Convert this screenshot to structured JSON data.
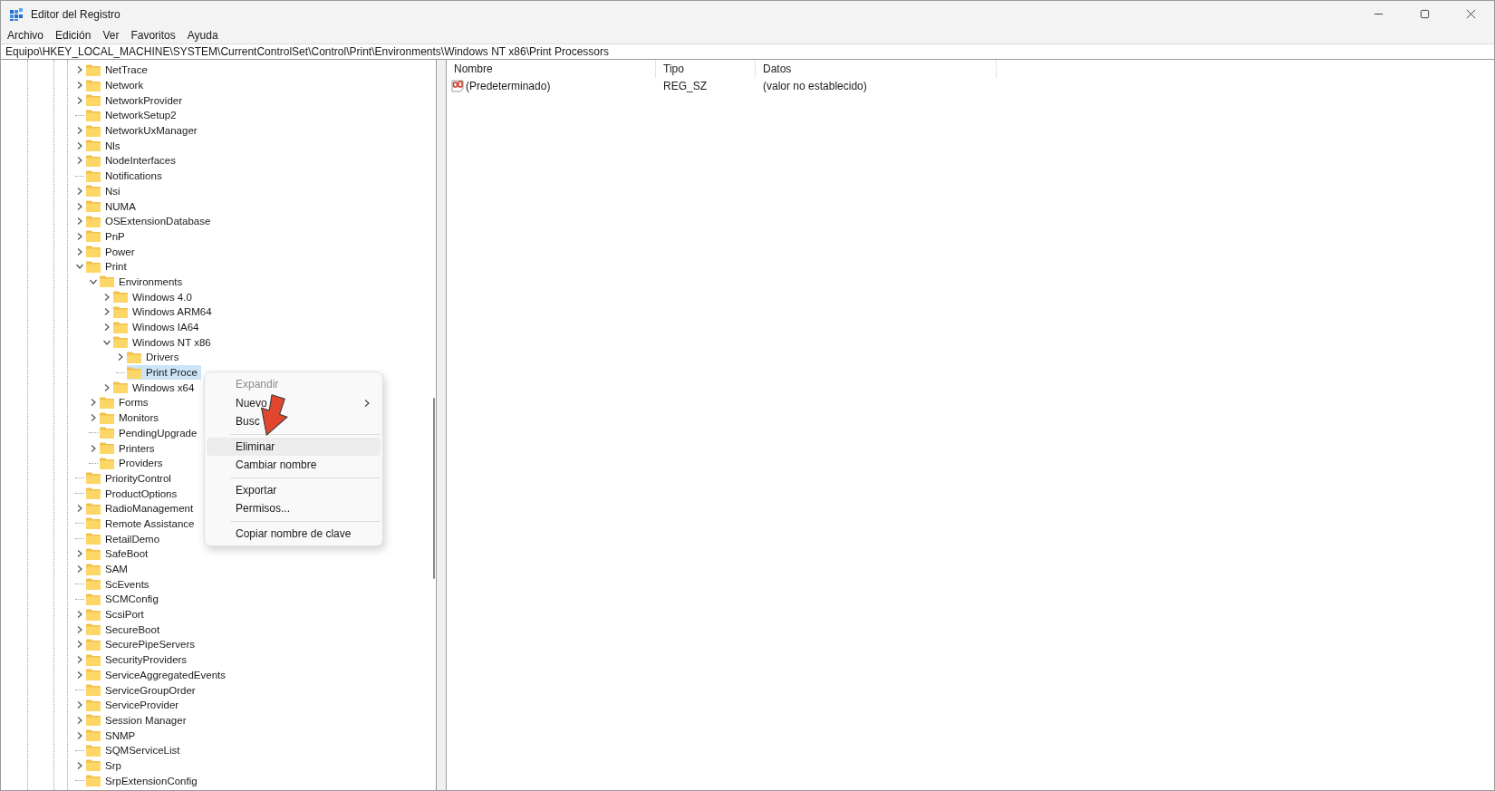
{
  "window": {
    "title": "Editor del Registro"
  },
  "menu": [
    "Archivo",
    "Edición",
    "Ver",
    "Favoritos",
    "Ayuda"
  ],
  "address": "Equipo\\HKEY_LOCAL_MACHINE\\SYSTEM\\CurrentControlSet\\Control\\Print\\Environments\\Windows NT x86\\Print Processors",
  "tree": [
    {
      "label": "NetTrace",
      "kind": "collapsed",
      "selected": false
    },
    {
      "label": "Network",
      "kind": "collapsed",
      "selected": false
    },
    {
      "label": "NetworkProvider",
      "kind": "collapsed",
      "selected": false
    },
    {
      "label": "NetworkSetup2",
      "kind": "leaf",
      "selected": false
    },
    {
      "label": "NetworkUxManager",
      "kind": "collapsed",
      "selected": false
    },
    {
      "label": "Nls",
      "kind": "collapsed",
      "selected": false
    },
    {
      "label": "NodeInterfaces",
      "kind": "collapsed",
      "selected": false
    },
    {
      "label": "Notifications",
      "kind": "leaf",
      "selected": false
    },
    {
      "label": "Nsi",
      "kind": "collapsed",
      "selected": false
    },
    {
      "label": "NUMA",
      "kind": "collapsed",
      "selected": false
    },
    {
      "label": "OSExtensionDatabase",
      "kind": "collapsed",
      "selected": false
    },
    {
      "label": "PnP",
      "kind": "collapsed",
      "selected": false
    },
    {
      "label": "Power",
      "kind": "collapsed",
      "selected": false
    },
    {
      "label": "Print",
      "kind": "expanded",
      "selected": false,
      "children": [
        {
          "label": "Environments",
          "kind": "expanded",
          "selected": false,
          "children": [
            {
              "label": "Windows 4.0",
              "kind": "collapsed",
              "selected": false
            },
            {
              "label": "Windows ARM64",
              "kind": "collapsed",
              "selected": false
            },
            {
              "label": "Windows IA64",
              "kind": "collapsed",
              "selected": false
            },
            {
              "label": "Windows NT x86",
              "kind": "expanded",
              "selected": false,
              "children": [
                {
                  "label": "Drivers",
                  "kind": "collapsed",
                  "selected": false
                },
                {
                  "label": "Print Proce",
                  "kind": "leaf",
                  "selected": true
                }
              ]
            },
            {
              "label": "Windows x64",
              "kind": "collapsed",
              "selected": false
            }
          ]
        },
        {
          "label": "Forms",
          "kind": "collapsed",
          "selected": false
        },
        {
          "label": "Monitors",
          "kind": "collapsed",
          "selected": false
        },
        {
          "label": "PendingUpgrade",
          "kind": "leaf",
          "selected": false
        },
        {
          "label": "Printers",
          "kind": "collapsed",
          "selected": false
        },
        {
          "label": "Providers",
          "kind": "leaf",
          "selected": false
        }
      ]
    },
    {
      "label": "PriorityControl",
      "kind": "leaf",
      "selected": false
    },
    {
      "label": "ProductOptions",
      "kind": "leaf",
      "selected": false
    },
    {
      "label": "RadioManagement",
      "kind": "collapsed",
      "selected": false
    },
    {
      "label": "Remote Assistance",
      "kind": "leaf",
      "selected": false
    },
    {
      "label": "RetailDemo",
      "kind": "leaf",
      "selected": false
    },
    {
      "label": "SafeBoot",
      "kind": "collapsed",
      "selected": false
    },
    {
      "label": "SAM",
      "kind": "collapsed",
      "selected": false
    },
    {
      "label": "ScEvents",
      "kind": "leaf",
      "selected": false
    },
    {
      "label": "SCMConfig",
      "kind": "leaf",
      "selected": false
    },
    {
      "label": "ScsiPort",
      "kind": "collapsed",
      "selected": false
    },
    {
      "label": "SecureBoot",
      "kind": "collapsed",
      "selected": false
    },
    {
      "label": "SecurePipeServers",
      "kind": "collapsed",
      "selected": false
    },
    {
      "label": "SecurityProviders",
      "kind": "collapsed",
      "selected": false
    },
    {
      "label": "ServiceAggregatedEvents",
      "kind": "collapsed",
      "selected": false
    },
    {
      "label": "ServiceGroupOrder",
      "kind": "leaf",
      "selected": false
    },
    {
      "label": "ServiceProvider",
      "kind": "collapsed",
      "selected": false
    },
    {
      "label": "Session Manager",
      "kind": "collapsed",
      "selected": false
    },
    {
      "label": "SNMP",
      "kind": "collapsed",
      "selected": false
    },
    {
      "label": "SQMServiceList",
      "kind": "leaf",
      "selected": false
    },
    {
      "label": "Srp",
      "kind": "collapsed",
      "selected": false
    },
    {
      "label": "SrpExtensionConfig",
      "kind": "leaf",
      "selected": false
    }
  ],
  "columns": [
    "Nombre",
    "Tipo",
    "Datos"
  ],
  "values": [
    {
      "name": "(Predeterminado)",
      "type": "REG_SZ",
      "data": "(valor no establecido)"
    }
  ],
  "context_menu": [
    {
      "kind": "item",
      "label": "Expandir",
      "disabled": true,
      "selected": false
    },
    {
      "kind": "submenu",
      "label": "Nuevo",
      "disabled": false,
      "selected": false
    },
    {
      "kind": "item",
      "label": "Busc",
      "disabled": false,
      "selected": false
    },
    {
      "kind": "separator"
    },
    {
      "kind": "item",
      "label": "Eliminar",
      "disabled": false,
      "selected": true
    },
    {
      "kind": "item",
      "label": "Cambiar nombre",
      "disabled": false,
      "selected": false
    },
    {
      "kind": "separator"
    },
    {
      "kind": "item",
      "label": "Exportar",
      "disabled": false,
      "selected": false
    },
    {
      "kind": "item",
      "label": "Permisos...",
      "disabled": false,
      "selected": false
    },
    {
      "kind": "separator"
    },
    {
      "kind": "item",
      "label": "Copiar nombre de clave",
      "disabled": false,
      "selected": false
    }
  ]
}
